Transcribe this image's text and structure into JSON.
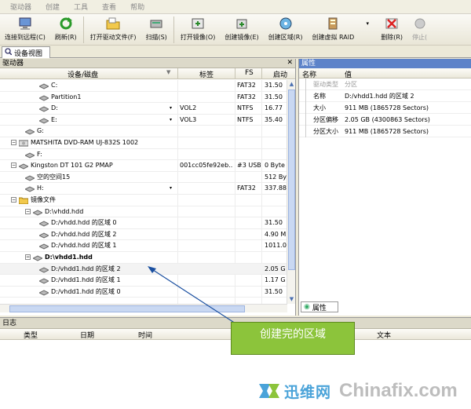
{
  "menu": [
    "驱动器",
    "创建",
    "工具",
    "查看",
    "帮助"
  ],
  "toolbar": [
    {
      "label": "连接到远程(C)",
      "icon": "remote-computer-icon"
    },
    {
      "label": "刷新(R)",
      "icon": "refresh-icon"
    },
    {
      "label": "打开驱动文件(F)",
      "icon": "open-folder-icon"
    },
    {
      "label": "扫描(S)",
      "icon": "scan-icon"
    },
    {
      "label": "打开镜像(O)",
      "icon": "open-image-icon"
    },
    {
      "label": "创建镜像(E)",
      "icon": "create-image-icon"
    },
    {
      "label": "创建区域(R)",
      "icon": "create-region-icon"
    },
    {
      "label": "创建虚拟 RAID",
      "icon": "virtual-raid-icon"
    },
    {
      "label": "删除(R)",
      "icon": "delete-icon"
    },
    {
      "label": "停止(",
      "icon": "stop-icon"
    }
  ],
  "tab": {
    "label": "设备视图"
  },
  "left": {
    "title": "驱动器",
    "columns": {
      "device": "设备/磁盘",
      "label": "标签",
      "fs": "FS",
      "start": "启动"
    },
    "rows": [
      {
        "indent": 3,
        "name": "C:",
        "label": "",
        "fs": "FAT32",
        "start": "31.50"
      },
      {
        "indent": 3,
        "name": "Partition1",
        "label": "",
        "fs": "FAT32",
        "start": "31.50"
      },
      {
        "indent": 3,
        "name": "D:",
        "label": "VOL2",
        "fs": "NTFS",
        "start": "16.77"
      },
      {
        "indent": 3,
        "name": "E:",
        "label": "VOL3",
        "fs": "NTFS",
        "start": "35.40"
      },
      {
        "indent": 2,
        "name": "G:",
        "label": "",
        "fs": "",
        "start": ""
      },
      {
        "indent": 1,
        "name": "MATSHITA DVD-RAM UJ-832S 1002",
        "label": "",
        "fs": "",
        "start": ""
      },
      {
        "indent": 2,
        "name": "F:",
        "label": "",
        "fs": "",
        "start": ""
      },
      {
        "indent": 1,
        "name": "Kingston DT 101 G2 PMAP",
        "label": "001cc05fe92eb...",
        "fs": "#3 USB",
        "start": "0 Byte"
      },
      {
        "indent": 2,
        "name": "空的空间15",
        "label": "",
        "fs": "",
        "start": "512 By"
      },
      {
        "indent": 2,
        "name": "H:",
        "label": "",
        "fs": "FAT32",
        "start": "337.88"
      },
      {
        "indent": 1,
        "name": "镜像文件",
        "label": "",
        "fs": "",
        "start": ""
      },
      {
        "indent": 2,
        "name": "D:\\vhdd.hdd",
        "label": "",
        "fs": "",
        "start": ""
      },
      {
        "indent": 3,
        "name": "D:/vhdd.hdd 的区域 0",
        "label": "",
        "fs": "",
        "start": "31.50"
      },
      {
        "indent": 3,
        "name": "D:/vhdd.hdd 的区域 2",
        "label": "",
        "fs": "",
        "start": "4.90 M"
      },
      {
        "indent": 3,
        "name": "D:/vhdd.hdd 的区域 1",
        "label": "",
        "fs": "",
        "start": "1011.0"
      },
      {
        "indent": 2,
        "name": "D:\\vhdd1.hdd",
        "label": "",
        "fs": "",
        "start": ""
      },
      {
        "indent": 3,
        "name": "D:/vhdd1.hdd 的区域 2",
        "label": "",
        "fs": "",
        "start": "2.05 G"
      },
      {
        "indent": 3,
        "name": "D:/vhdd1.hdd 的区域 1",
        "label": "",
        "fs": "",
        "start": "1.17 G"
      },
      {
        "indent": 3,
        "name": "D:/vhdd1.hdd 的区域 0",
        "label": "",
        "fs": "",
        "start": "31.50"
      }
    ]
  },
  "right": {
    "title": "属性",
    "columns": {
      "name": "名称",
      "value": "值"
    },
    "rows": [
      {
        "k": "驱动类型",
        "v": "分区"
      },
      {
        "k": "名称",
        "v": "D:/vhdd1.hdd 的区域 2"
      },
      {
        "k": "大小",
        "v": "911 MB (1865728 Sectors)"
      },
      {
        "k": "分区偏移",
        "v": "2.05 GB (4300863 Sectors)"
      },
      {
        "k": "分区大小",
        "v": "911 MB (1865728 Sectors)"
      }
    ],
    "tab": "属性"
  },
  "log": {
    "title": "日志",
    "columns": {
      "type": "类型",
      "date": "日期",
      "time": "时间",
      "text": "文本"
    }
  },
  "callout": {
    "text": "创建完的区域"
  },
  "watermark": {
    "cn": "迅维网",
    "en": "Chinafix.com"
  }
}
